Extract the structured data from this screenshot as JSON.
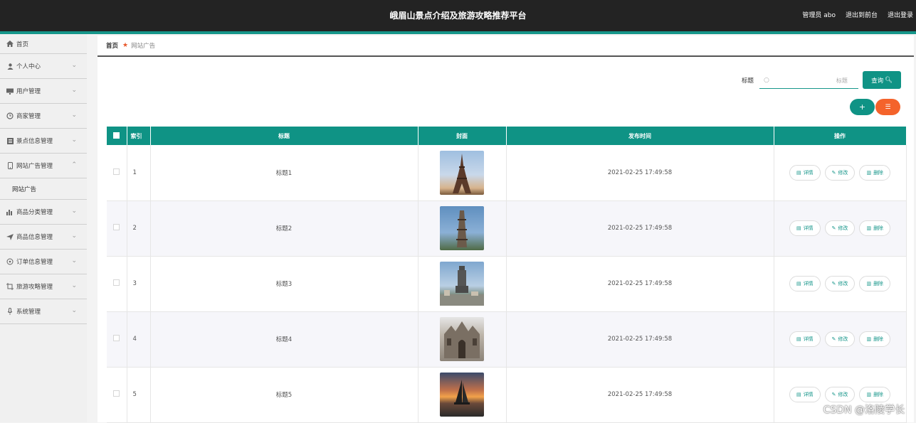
{
  "header": {
    "title": "峨眉山景点介绍及旅游攻略推荐平台",
    "admin_label": "管理员 abo",
    "to_frontend": "退出到前台",
    "logout": "退出登录"
  },
  "sidebar": {
    "items": [
      {
        "label": "首页",
        "icon": "home-icon",
        "expandable": false
      },
      {
        "label": "个人中心",
        "icon": "user-icon",
        "expandable": true
      },
      {
        "label": "用户管理",
        "icon": "monitor-icon",
        "expandable": true
      },
      {
        "label": "商家管理",
        "icon": "clock-icon",
        "expandable": true
      },
      {
        "label": "景点信息管理",
        "icon": "list-icon",
        "expandable": true
      },
      {
        "label": "网站广告管理",
        "icon": "phone-icon",
        "expandable": true,
        "expanded": true,
        "children": [
          {
            "label": "网站广告"
          }
        ]
      },
      {
        "label": "商品分类管理",
        "icon": "bar-chart-icon",
        "expandable": true
      },
      {
        "label": "商品信息管理",
        "icon": "send-icon",
        "expandable": true
      },
      {
        "label": "订单信息管理",
        "icon": "target-icon",
        "expandable": true
      },
      {
        "label": "旅游攻略管理",
        "icon": "crop-icon",
        "expandable": true
      },
      {
        "label": "系统管理",
        "icon": "mic-icon",
        "expandable": true
      }
    ]
  },
  "breadcrumb": {
    "home": "首页",
    "current": "网站广告"
  },
  "search": {
    "label": "标题",
    "placeholder": "标题",
    "button": "查询"
  },
  "actions": {
    "add": "+",
    "delete": "☰"
  },
  "table": {
    "headers": [
      "索引",
      "标题",
      "封面",
      "发布时间",
      "操作"
    ],
    "rows": [
      {
        "index": "1",
        "title": "标题1",
        "time": "2021-02-25 17:49:58"
      },
      {
        "index": "2",
        "title": "标题2",
        "time": "2021-02-25 17:49:58"
      },
      {
        "index": "3",
        "title": "标题3",
        "time": "2021-02-25 17:49:58"
      },
      {
        "index": "4",
        "title": "标题4",
        "time": "2021-02-25 17:49:58"
      },
      {
        "index": "5",
        "title": "标题5",
        "time": "2021-02-25 17:49:58"
      }
    ],
    "ops": {
      "detail": "详情",
      "edit": "修改",
      "delete": "删除"
    }
  },
  "watermark": "CSDN @洛陵学长",
  "colors": {
    "accent": "#0f9385",
    "danger": "#f4632b",
    "topbar": "#232323"
  }
}
